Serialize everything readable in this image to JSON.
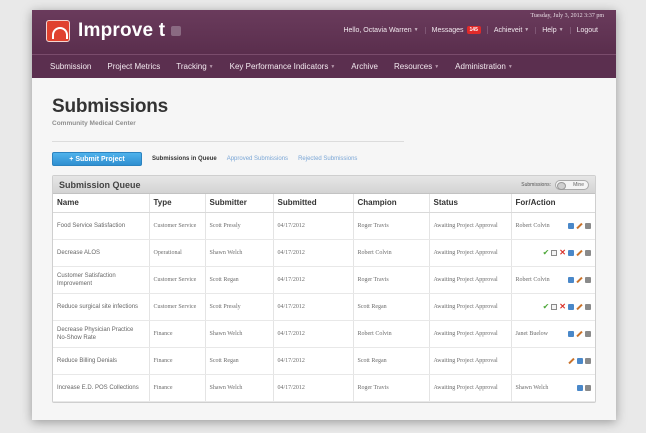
{
  "header": {
    "brand": "Improve t",
    "datetime": "Tuesday, July 3, 2012 3:37 pm",
    "greeting": "Hello, Octavia Warren",
    "messages_label": "Messages",
    "messages_count": "145",
    "achieveit_label": "Achieveit",
    "help_label": "Help",
    "logout_label": "Logout"
  },
  "menu": [
    {
      "label": "Submission",
      "dropdown": false
    },
    {
      "label": "Project Metrics",
      "dropdown": false
    },
    {
      "label": "Tracking",
      "dropdown": true
    },
    {
      "label": "Key Performance Indicators",
      "dropdown": true
    },
    {
      "label": "Archive",
      "dropdown": false
    },
    {
      "label": "Resources",
      "dropdown": true
    },
    {
      "label": "Administration",
      "dropdown": true
    }
  ],
  "page": {
    "title": "Submissions",
    "subtitle": "Community Medical Center"
  },
  "tabs": {
    "submit_button": "+ Submit Project",
    "queue_tab": "Submissions in Queue",
    "approved_tab": "Approved Submissions",
    "rejected_tab": "Rejected Submissions"
  },
  "queue": {
    "title": "Submission Queue",
    "toggle_label": "Submissions:",
    "toggle_value": "Mine",
    "columns": [
      "Name",
      "Type",
      "Submitter",
      "Submitted",
      "Champion",
      "Status",
      "For/Action"
    ],
    "rows": [
      {
        "name": "Food Service Satisfaction",
        "type": "Customer Service",
        "submitter": "Scott Pressly",
        "submitted": "04/17/2012",
        "champion": "Roger Travis",
        "status": "Awaiting Project Approval",
        "for": "Robert Colvin",
        "actions": [
          "comment-icon",
          "pencil-icon",
          "trash-icon"
        ]
      },
      {
        "name": "Decrease ALOS",
        "type": "Operational",
        "submitter": "Shawn Welch",
        "submitted": "04/17/2012",
        "champion": "Robert Colvin",
        "status": "Awaiting Project Approval",
        "for": "",
        "actions": [
          "check-icon",
          "document-icon",
          "reject-icon",
          "comment-icon",
          "pencil-icon",
          "trash-icon"
        ]
      },
      {
        "name": "Customer Satisfaction Improvement",
        "type": "Customer Service",
        "submitter": "Scott Regan",
        "submitted": "04/17/2012",
        "champion": "Roger Travis",
        "status": "Awaiting Project Approval",
        "for": "Robert Colvin",
        "actions": [
          "comment-icon",
          "pencil-icon",
          "trash-icon"
        ]
      },
      {
        "name": "Reduce surgical site infections",
        "type": "Customer Service",
        "submitter": "Scott Pressly",
        "submitted": "04/17/2012",
        "champion": "Scott Regan",
        "status": "Awaiting Project Approval",
        "for": "",
        "actions": [
          "check-icon",
          "document-icon",
          "reject-icon",
          "comment-icon",
          "pencil-icon",
          "trash-icon"
        ]
      },
      {
        "name": "Decrease Physician Practice No-Show Rate",
        "type": "Finance",
        "submitter": "Shawn Welch",
        "submitted": "04/17/2012",
        "champion": "Robert Colvin",
        "status": "Awaiting Project Approval",
        "for": "Janet Buelow",
        "actions": [
          "comment-icon",
          "pencil-icon",
          "trash-icon"
        ]
      },
      {
        "name": "Reduce Billing Denials",
        "type": "Finance",
        "submitter": "Scott Regan",
        "submitted": "04/17/2012",
        "champion": "Scott Regan",
        "status": "Awaiting Project Approval",
        "for": "",
        "actions": [
          "pencil-icon",
          "comment-icon",
          "trash-icon"
        ]
      },
      {
        "name": "Increase E.D. POS Collections",
        "type": "Finance",
        "submitter": "Shawn Welch",
        "submitted": "04/17/2012",
        "champion": "Roger Travis",
        "status": "Awaiting Project Approval",
        "for": "Shawn Welch",
        "actions": [
          "comment-icon",
          "trash-icon"
        ]
      }
    ]
  }
}
